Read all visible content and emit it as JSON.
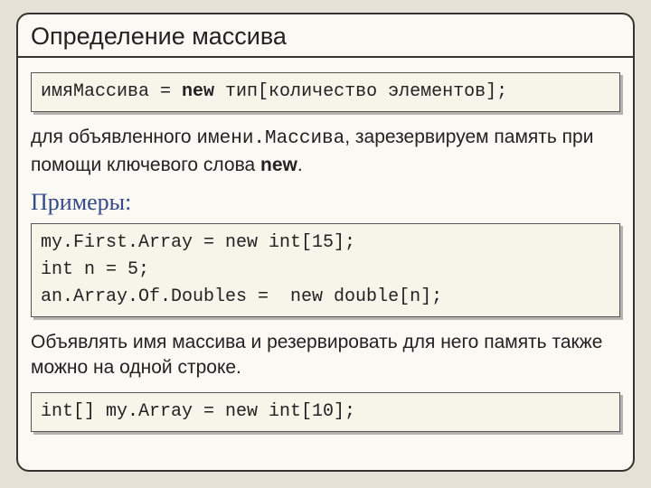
{
  "title": "Определение массива",
  "code1": {
    "pre": "имяМассива = ",
    "kw": "new",
    "post": " тип[количество элементов];"
  },
  "para1": {
    "t1": "для объявленного ",
    "mono": "имени.Массива",
    "t2": ", зарезервируем память при помощи ключевого слова ",
    "bold": "new",
    "t3": "."
  },
  "subhead": "Примеры:",
  "code2": "my.First.Array = new int[15];\nint n = 5;\nan.Array.Of.Doubles =  new double[n];",
  "para2": "Объявлять имя массива и резервировать для него память также можно на одной строке.",
  "code3": "int[] my.Array = new int[10];"
}
